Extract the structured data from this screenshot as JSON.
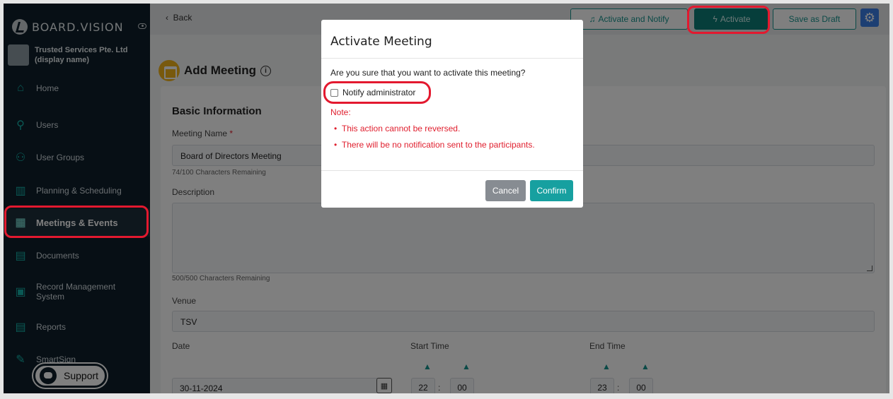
{
  "sidebar": {
    "logo": "BOARD.VISION",
    "org_name": "Trusted Services Pte. Ltd (display name)",
    "items": [
      {
        "label": "Home"
      },
      {
        "label": "Users"
      },
      {
        "label": "User Groups"
      },
      {
        "label": "Planning & Scheduling"
      },
      {
        "label": "Meetings & Events"
      },
      {
        "label": "Documents"
      },
      {
        "label": "Record Management System"
      },
      {
        "label": "Reports"
      },
      {
        "label": "SmartSign"
      }
    ],
    "support_label": "Support"
  },
  "topbar": {
    "back_label": "Back",
    "activate_notify_label": "Activate and Notify",
    "activate_label": "Activate",
    "save_draft_label": "Save as Draft"
  },
  "page": {
    "title": "Add Meeting",
    "section_title": "Basic Information",
    "meeting_name_label": "Meeting Name",
    "meeting_name_value": "Board of Directors Meeting",
    "meeting_name_hint": "74/100 Characters Remaining",
    "description_label": "Description",
    "description_hint": "500/500 Characters Remaining",
    "venue_label": "Venue",
    "venue_value": "TSV",
    "date_label": "Date",
    "date_value": "30-11-2024",
    "start_time_label": "Start Time",
    "start_hour": "22",
    "start_min": "00",
    "end_time_label": "End Time",
    "end_hour": "23",
    "end_min": "00"
  },
  "modal": {
    "title": "Activate Meeting",
    "question": "Are you sure that you want to activate this meeting?",
    "checkbox_label": "Notify administrator",
    "note_label": "Note:",
    "notes": [
      "This action cannot be reversed.",
      "There will be no notification sent to the participants."
    ],
    "cancel_label": "Cancel",
    "confirm_label": "Confirm"
  },
  "colors": {
    "sidebar_bg": "#0e1f2a",
    "accent": "#17948e",
    "primary_dark": "#0d7d77",
    "highlight": "#e3192f",
    "warning_text": "#e0202f",
    "gear_blue": "#3b7ee6"
  }
}
